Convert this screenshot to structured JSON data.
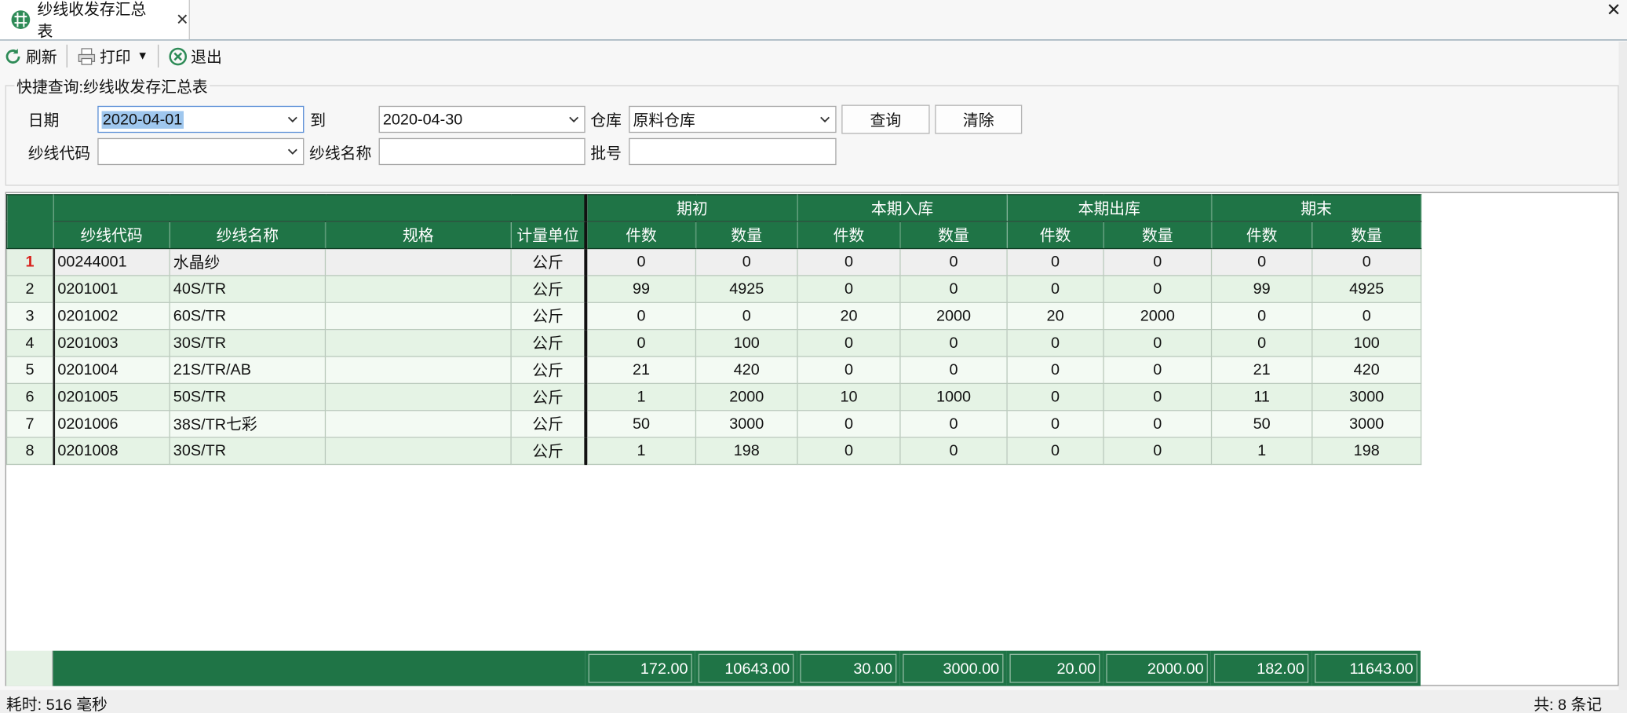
{
  "window": {
    "close_label": "✕"
  },
  "tab": {
    "title": "纱线收发存汇总表",
    "close_label": "✕",
    "icon": "sheet-icon"
  },
  "toolbar": {
    "refresh_label": "刷新",
    "print_label": "打印",
    "print_dropdown": "▼",
    "exit_label": "退出"
  },
  "query": {
    "group_title": "快捷查询:纱线收发存汇总表",
    "date_label": "日期",
    "date_from": "2020-04-01",
    "to_label": "到",
    "date_to": "2020-04-30",
    "warehouse_label": "仓库",
    "warehouse": "原料仓库",
    "search_button": "查询",
    "clear_button": "清除",
    "yarn_code_label": "纱线代码",
    "yarn_code": "",
    "yarn_name_label": "纱线名称",
    "yarn_name": "",
    "batch_label": "批号",
    "batch": ""
  },
  "grid": {
    "group_headers": [
      "期初",
      "本期入库",
      "本期出库",
      "期末"
    ],
    "columns": [
      "纱线代码",
      "纱线名称",
      "规格",
      "计量单位",
      "件数",
      "数量",
      "件数",
      "数量",
      "件数",
      "数量",
      "件数",
      "数量"
    ],
    "rows": [
      [
        "1",
        "00244001",
        "水晶纱",
        "",
        "公斤",
        "0",
        "0",
        "0",
        "0",
        "0",
        "0",
        "0",
        "0"
      ],
      [
        "2",
        "0201001",
        "40S/TR",
        "",
        "公斤",
        "99",
        "4925",
        "0",
        "0",
        "0",
        "0",
        "99",
        "4925"
      ],
      [
        "3",
        "0201002",
        "60S/TR",
        "",
        "公斤",
        "0",
        "0",
        "20",
        "2000",
        "20",
        "2000",
        "0",
        "0"
      ],
      [
        "4",
        "0201003",
        "30S/TR",
        "",
        "公斤",
        "0",
        "100",
        "0",
        "0",
        "0",
        "0",
        "0",
        "100"
      ],
      [
        "5",
        "0201004",
        "21S/TR/AB",
        "",
        "公斤",
        "21",
        "420",
        "0",
        "0",
        "0",
        "0",
        "21",
        "420"
      ],
      [
        "6",
        "0201005",
        "50S/TR",
        "",
        "公斤",
        "1",
        "2000",
        "10",
        "1000",
        "0",
        "0",
        "11",
        "3000"
      ],
      [
        "7",
        "0201006",
        "38S/TR七彩",
        "",
        "公斤",
        "50",
        "3000",
        "0",
        "0",
        "0",
        "0",
        "50",
        "3000"
      ],
      [
        "8",
        "0201008",
        "30S/TR",
        "",
        "公斤",
        "1",
        "198",
        "0",
        "0",
        "0",
        "0",
        "1",
        "198"
      ]
    ],
    "totals": [
      "172.00",
      "10643.00",
      "30.00",
      "3000.00",
      "20.00",
      "2000.00",
      "182.00",
      "11643.00"
    ]
  },
  "status": {
    "elapsed": "耗时: 516 毫秒",
    "count": "共: 8 条记"
  },
  "colors": {
    "header_green": "#1f7446",
    "row_light_green": "#e5f3e5",
    "row_lighter_green": "#f3faf3",
    "selected_row": "#efefef",
    "row_marker_red": "#d8201b"
  }
}
